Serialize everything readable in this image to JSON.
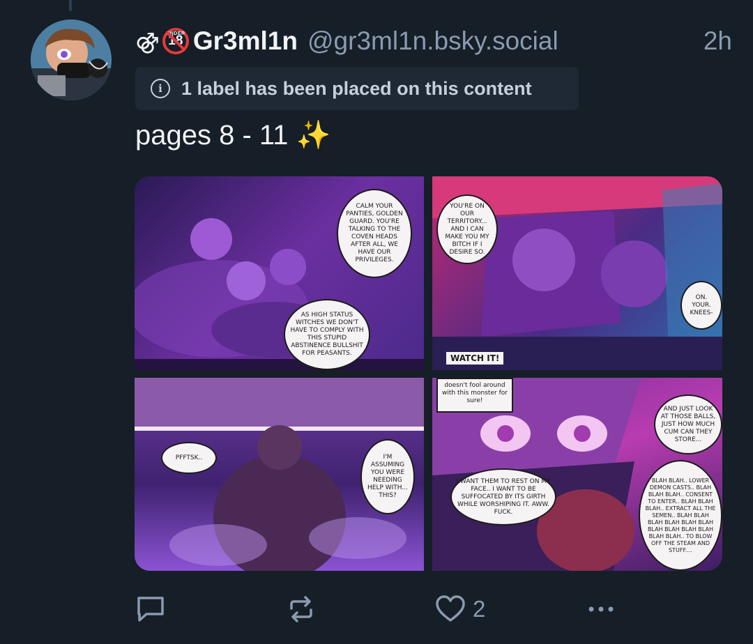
{
  "post": {
    "name_emojis": "⚣",
    "age_badge_top": "UNDER",
    "age_badge_number": "18",
    "display_name": "Gr3ml1n",
    "handle": "@gr3ml1n.bsky.social",
    "time": "2h",
    "label_notice": "1 label has been placed on this content",
    "text": "pages 8 - 11",
    "text_emoji": "✨"
  },
  "media": {
    "panel1": {
      "bubble_top": "Calm your panties, Golden Guard. You're talking to the coven heads after all, we have our PRIVILEGES.",
      "bubble_bottom": "As high status witches we don't have to comply with this stupid abstinence BULLSHIT for peasants."
    },
    "panel2": {
      "bubble_left": "You're on our territory... and I can make you my bitch if I desire so.",
      "bubble_right": "On. Your. Knees-",
      "sfx": "WATCH IT!"
    },
    "panel3": {
      "bubble_left": "PFFTSK..",
      "bubble_right": "I'm assuming you were needing help with... this?"
    },
    "panel4": {
      "caption_top": "doesn't fool around with this monster for sure!",
      "bubble_right": "And just look at those balls, just how much cum can they store...",
      "bubble_left": "I want them to rest on my face.. I want to be suffocated by its girth while worshiping it. Aww. Fuck.",
      "bubble_bottom": "Blah blah.. LOWER DEMON CASTS.. Blah blah blah.. CONSENT TO ENTER.. Blah blah blah.. EXTRACT ALL THE SEMEN.. Blah blah blah blah blah blah blah blah blah blah blah blah.. TO BLOW OFF THE STEAM AND STUFF...."
    }
  },
  "actions": {
    "like_count": "2"
  },
  "icons": {
    "reply": "reply-bubble-icon",
    "repost": "repost-arrows-icon",
    "like": "heart-icon",
    "more": "more-dots-icon",
    "info": "info-circle-icon"
  },
  "colors": {
    "background": "#161e27",
    "muted_text": "#8a9bb0",
    "pill_bg": "#1e2935",
    "badge_red": "#e33a3a"
  }
}
